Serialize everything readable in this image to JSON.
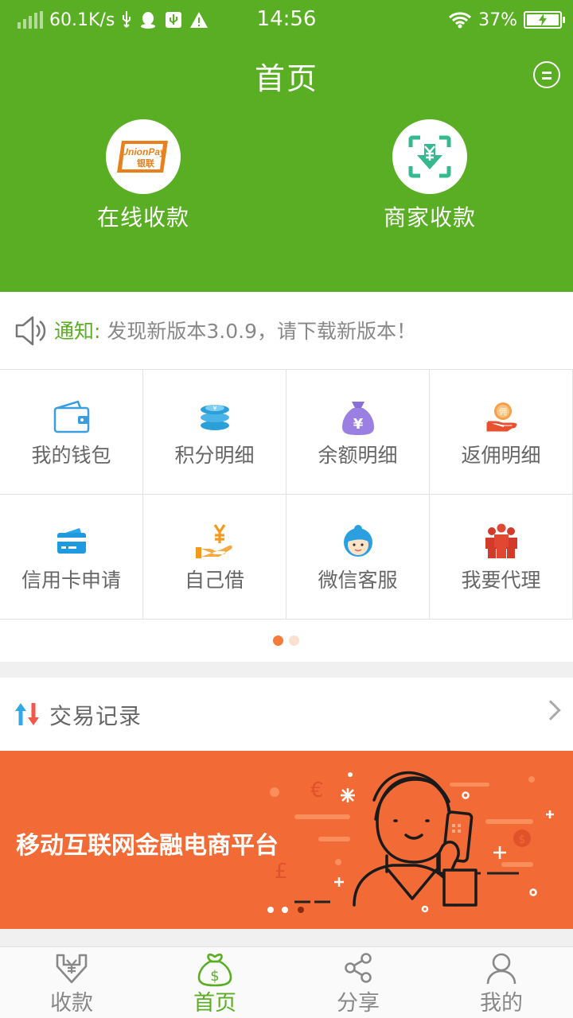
{
  "statusbar": {
    "net_speed": "60.1K/s",
    "time": "14:56",
    "battery": "37%"
  },
  "header": {
    "title": "首页"
  },
  "hero": [
    {
      "label": "在线收款",
      "icon": "unionpay-icon",
      "logo_text": "UnionPay",
      "logo_sub": "银联"
    },
    {
      "label": "商家收款",
      "icon": "scan-yen-icon"
    }
  ],
  "notice": {
    "label": "通知:",
    "text": "发现新版本3.0.9，请下载新版本！"
  },
  "grid": [
    {
      "label": "我的钱包",
      "icon": "wallet-icon"
    },
    {
      "label": "积分明细",
      "icon": "coins-icon"
    },
    {
      "label": "余额明细",
      "icon": "money-bag-icon"
    },
    {
      "label": "返佣明细",
      "icon": "commission-icon",
      "icon_text": "佣"
    },
    {
      "label": "信用卡申请",
      "icon": "credit-card-icon"
    },
    {
      "label": "自己借",
      "icon": "loan-hand-icon"
    },
    {
      "label": "微信客服",
      "icon": "customer-service-icon"
    },
    {
      "label": "我要代理",
      "icon": "agents-icon"
    }
  ],
  "pager": {
    "pages": 2,
    "current": 1
  },
  "transactions": {
    "label": "交易记录",
    "icon": "refresh-arrows-icon"
  },
  "banner": {
    "text": "移动互联网金融电商平台",
    "illustration": "man-with-phone-illustration"
  },
  "tabbar": [
    {
      "label": "收款",
      "icon": "receive-icon",
      "active": false
    },
    {
      "label": "首页",
      "icon": "home-money-icon",
      "active": true
    },
    {
      "label": "分享",
      "icon": "share-icon",
      "active": false
    },
    {
      "label": "我的",
      "icon": "user-icon",
      "active": false
    }
  ],
  "colors": {
    "primary_green": "#5aae24",
    "banner_orange": "#f26b36",
    "active_dot": "#f47b3a"
  }
}
